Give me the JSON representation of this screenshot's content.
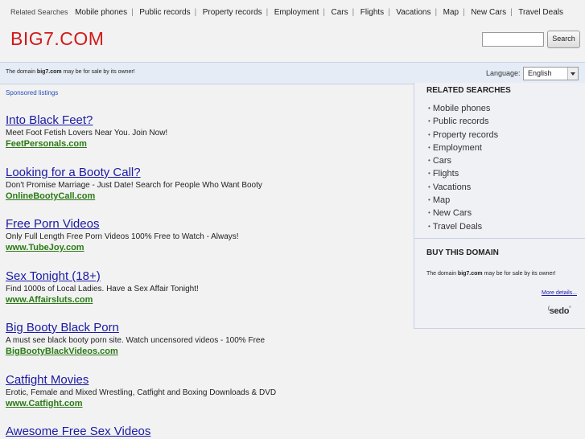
{
  "topbar": {
    "label": "Related Searches",
    "links": [
      "Mobile phones",
      "Public records",
      "Property records",
      "Employment",
      "Cars",
      "Flights",
      "Vacations",
      "Map",
      "New Cars",
      "Travel Deals"
    ],
    "separator": "|"
  },
  "logo": "BIG7.COM",
  "search": {
    "value": "",
    "button_label": "Search"
  },
  "banner": {
    "text_before": "The domain ",
    "domain": "big7.com",
    "text_after": " may be for sale by its owner!",
    "language_label": "Language:",
    "language_value": "English"
  },
  "sponsored_label": "Sponsored listings",
  "ads": [
    {
      "title": "Into Black Feet?",
      "desc": "Meet Foot Fetish Lovers Near You. Join Now!",
      "url": "FeetPersonals.com"
    },
    {
      "title": "Looking for a Booty Call?",
      "desc": "Don't Promise Marriage - Just Date! Search for People Who Want Booty",
      "url": "OnlineBootyCall.com"
    },
    {
      "title": "Free Porn Videos",
      "desc": "Only Full Length Free Porn Videos 100% Free to Watch - Always!",
      "url": "www.TubeJoy.com"
    },
    {
      "title": "Sex Tonight (18+)",
      "desc": "Find 1000s of Local Ladies. Have a Sex Affair Tonight!",
      "url": "www.Affairsluts.com"
    },
    {
      "title": "Big Booty Black Porn",
      "desc": "A must see black booty porn site. Watch uncensored videos - 100% Free",
      "url": "BigBootyBlackVideos.com"
    },
    {
      "title": "Catfight Movies",
      "desc": "Erotic, Female and Mixed Wrestling, Catfight and Boxing Downloads & DVD",
      "url": "www.Catfight.com"
    },
    {
      "title": "Awesome Free Sex Videos",
      "desc": "",
      "url": ""
    }
  ],
  "sidebar": {
    "related_heading": "RELATED SEARCHES",
    "related_items": [
      "Mobile phones",
      "Public records",
      "Property records",
      "Employment",
      "Cars",
      "Flights",
      "Vacations",
      "Map",
      "New Cars",
      "Travel Deals"
    ],
    "bullet": "•",
    "buy_heading": "BUY THIS DOMAIN",
    "buy_text_before": "The domain ",
    "buy_domain": "big7.com",
    "buy_text_after": " may be for sale by its owner!",
    "more_details": "More details...",
    "sedo_logo": "sedo"
  }
}
